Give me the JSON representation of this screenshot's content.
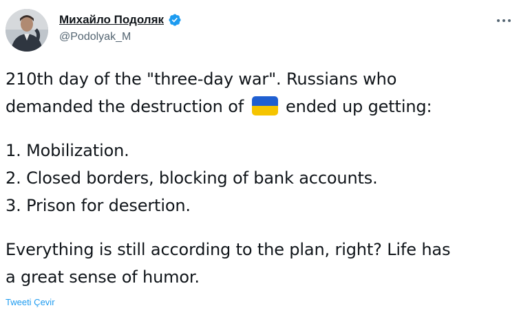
{
  "author": {
    "display_name": "Михайло Подоляк",
    "handle": "@Podolyak_M",
    "verified_icon": "verified-badge-icon",
    "avatar_icon": "profile-photo"
  },
  "more_icon": "more-options-icon",
  "tweet": {
    "line1": "210th day of the \"three-day war\". Russians who",
    "line2_before": "demanded the destruction of",
    "flag_icon": "ukraine-flag-emoji",
    "line2_after": "ended up getting:",
    "item1": "1. Mobilization.",
    "item2": "2. Closed borders, blocking of bank accounts.",
    "item3": "3. Prison for desertion.",
    "closing1": "Everything is still according to the plan, right? Life has",
    "closing2": "a great sense of humor."
  },
  "translate_label": "Tweeti Çevir",
  "colors": {
    "accent": "#1d9bf0",
    "secondary_text": "#536471",
    "flag_blue": "#1f5fd1",
    "flag_yellow": "#f5c400"
  }
}
